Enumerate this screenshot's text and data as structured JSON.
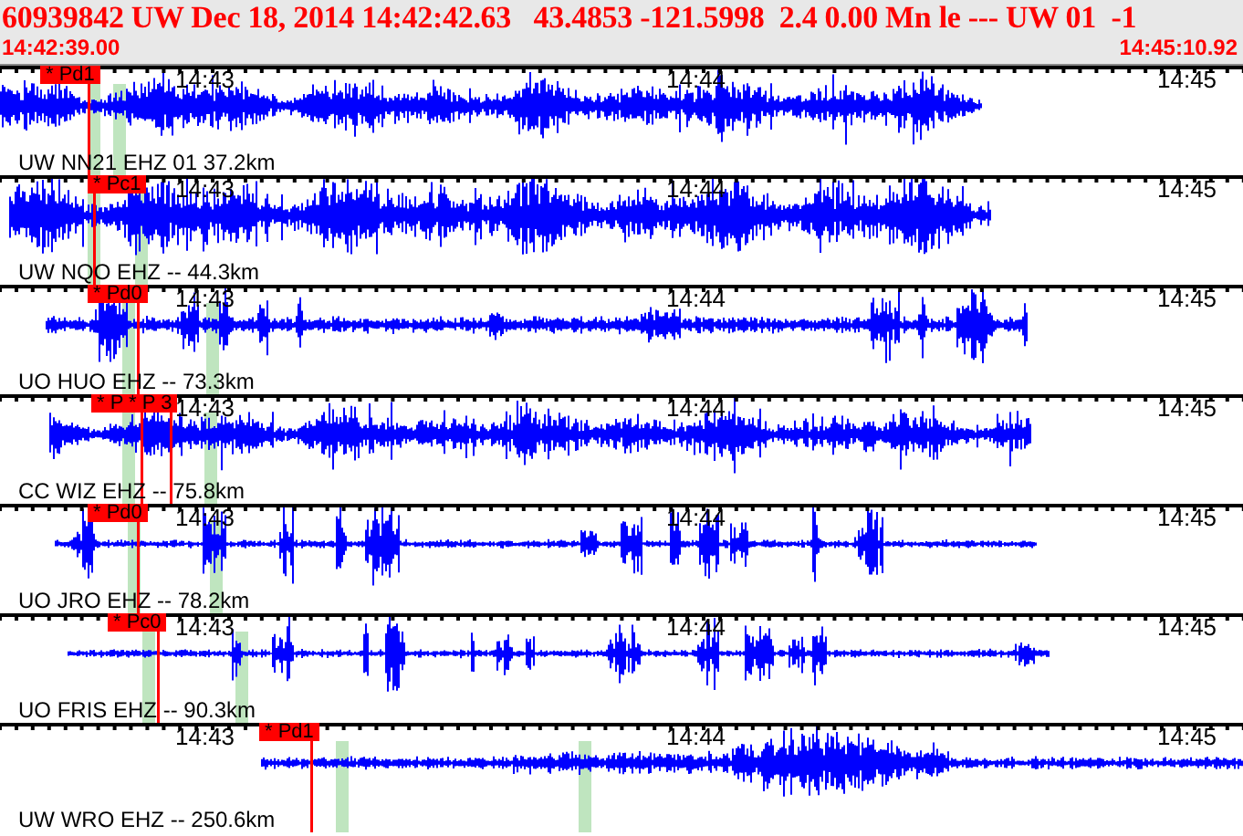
{
  "header": {
    "event_line": "60939842 UW Dec 18, 2014 14:42:42.63   43.4853 -121.5998  2.4 0.00 Mn le --- UW 01  -1",
    "start_time": "14:42:39.00",
    "end_time": "14:45:10.92"
  },
  "traces": [
    {
      "station": "UW NN21 EHZ 01 37.2km",
      "tick_labels": [
        "14:43",
        "14:44",
        "14:45"
      ],
      "picks": [
        "* Pd1"
      ]
    },
    {
      "station": "UW NQO EHZ -- 44.3km",
      "tick_labels": [
        "14:43",
        "14:44",
        "14:45"
      ],
      "picks": [
        "* Pc1"
      ]
    },
    {
      "station": "UO HUO EHZ -- 73.3km",
      "tick_labels": [
        "14:43",
        "14:44",
        "14:45"
      ],
      "picks": [
        "* Pd0"
      ]
    },
    {
      "station": "CC WIZ EHZ -- 75.8km",
      "tick_labels": [
        "14:43",
        "14:44",
        "14:45"
      ],
      "picks": [
        "* P * P 3"
      ]
    },
    {
      "station": "UO JRO EHZ -- 78.2km",
      "tick_labels": [
        "14:43",
        "14:44",
        "14:45"
      ],
      "picks": [
        "* Pd0"
      ]
    },
    {
      "station": "UO FRIS EHZ -- 90.3km",
      "tick_labels": [
        "14:43",
        "14:44",
        "14:45"
      ],
      "picks": [
        "* Pc0"
      ]
    },
    {
      "station": "UW WRO EHZ -- 250.6km",
      "tick_labels": [
        "14:43",
        "14:44",
        "14:45"
      ],
      "picks": [
        "* Pd1"
      ]
    }
  ]
}
